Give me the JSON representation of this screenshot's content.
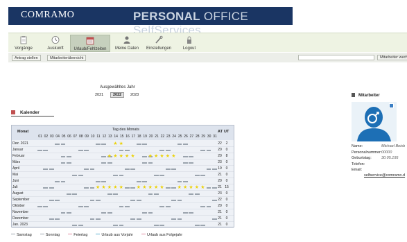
{
  "header": {
    "logo": "COMRAMO",
    "product_bold": "PERSONAL",
    "product_rest": " OFFICE SelfServices"
  },
  "nav": {
    "items": [
      {
        "label": "Vorgänge",
        "icon": "clipboard-icon"
      },
      {
        "label": "Auskunft",
        "icon": "clock-icon"
      },
      {
        "label": "Urlaub/Fehlzeiten",
        "icon": "calendar-icon"
      },
      {
        "label": "Meine Daten",
        "icon": "person-icon"
      },
      {
        "label": "Einstellungen",
        "icon": "wrench-icon"
      },
      {
        "label": "Logout",
        "icon": "lock-icon"
      }
    ]
  },
  "toolbar": {
    "antrag": "Antrag stellen",
    "uebersicht": "Mitarbeiterübersicht",
    "search_placeholder": "",
    "search_button": "Mitarbeiter wechseln"
  },
  "year": {
    "title": "Ausgewähltes Jahr",
    "prev": "2021",
    "current": "2022",
    "next": "2023"
  },
  "calendar": {
    "title": "Kalender",
    "column_month": "Monat",
    "column_days": "Tag des Monats",
    "column_at": "AT",
    "column_ut": "UT",
    "days": [
      "01",
      "02",
      "03",
      "04",
      "05",
      "06",
      "07",
      "08",
      "09",
      "10",
      "11",
      "12",
      "13",
      "14",
      "15",
      "16",
      "17",
      "18",
      "19",
      "20",
      "21",
      "22",
      "23",
      "24",
      "25",
      "26",
      "27",
      "28",
      "29",
      "30",
      "31"
    ],
    "months": [
      {
        "name": "Dez. 2021",
        "at": "22",
        "ut": "2"
      },
      {
        "name": "Januar",
        "at": "20",
        "ut": "0"
      },
      {
        "name": "Februar",
        "at": "20",
        "ut": "8"
      },
      {
        "name": "März",
        "at": "23",
        "ut": "0"
      },
      {
        "name": "April",
        "at": "19",
        "ut": "0"
      },
      {
        "name": "Mai",
        "at": "21",
        "ut": "0"
      },
      {
        "name": "Juni",
        "at": "20",
        "ut": "0"
      },
      {
        "name": "Juli",
        "at": "21",
        "ut": "15"
      },
      {
        "name": "August",
        "at": "23",
        "ut": "0"
      },
      {
        "name": "September",
        "at": "22",
        "ut": "0"
      },
      {
        "name": "Oktober",
        "at": "20",
        "ut": "0"
      },
      {
        "name": "November",
        "at": "21",
        "ut": "0"
      },
      {
        "name": "Dezember",
        "at": "21",
        "ut": "0"
      },
      {
        "name": "Jan. 2023",
        "at": "21",
        "ut": "0"
      }
    ],
    "vacation_days": [
      [
        14,
        15
      ],
      [],
      [
        13,
        14,
        15,
        16,
        17,
        20,
        21,
        22,
        23,
        24
      ],
      [],
      [],
      [],
      [],
      [
        11,
        12,
        13,
        14,
        15,
        18,
        19,
        20,
        21,
        22,
        25,
        26,
        27,
        28,
        29
      ],
      [],
      [],
      [],
      [],
      [],
      []
    ],
    "colors": {
      "saturday": "#9aa3ad",
      "sunday": "#9aa3ad",
      "holiday": "#e08aa0",
      "vacation": "#ecd20a"
    }
  },
  "legend": [
    {
      "label": "Samstag",
      "color": "#9aa3ad"
    },
    {
      "label": "Sonntag",
      "color": "#9aa3ad"
    },
    {
      "label": "Feiertag",
      "color": "#e08aa0"
    },
    {
      "label": "Urlaub aus Vorjahr",
      "color": "#5fb0d0"
    },
    {
      "label": "Urlaub aus Folgejahr",
      "color": "#e08aa0"
    }
  ],
  "employee": {
    "title": "Mitarbeiter",
    "fields": [
      {
        "label": "Name:",
        "value": "Michael Beisb"
      },
      {
        "label": "Personalnummer:",
        "value": "00000"
      },
      {
        "label": "Geburtstag:",
        "value": "30.05.195"
      },
      {
        "label": "Telefon:",
        "value": ""
      },
      {
        "label": "Email:",
        "value": ""
      }
    ],
    "email": "selfservice@comramo.d"
  }
}
